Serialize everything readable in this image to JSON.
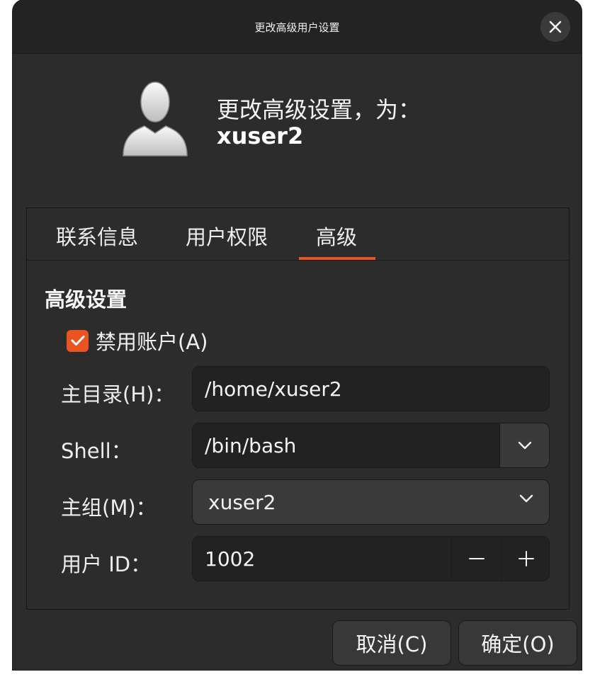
{
  "window": {
    "title": "更改高级用户设置",
    "close_icon": "close-icon"
  },
  "header": {
    "line1": "更改高级设置，为：",
    "username": "xuser2",
    "avatar_icon": "user-avatar-icon"
  },
  "tabs": [
    {
      "label": "联系信息",
      "active": false
    },
    {
      "label": "用户权限",
      "active": false
    },
    {
      "label": "高级",
      "active": true
    }
  ],
  "advanced": {
    "section_title": "高级设置",
    "disable_account": {
      "label": "禁用账户(A)",
      "checked": true
    },
    "home_dir": {
      "label": "主目录(H)：",
      "value": "/home/xuser2"
    },
    "shell": {
      "label": "Shell：",
      "value": "/bin/bash"
    },
    "main_group": {
      "label": "主组(M)：",
      "value": "xuser2"
    },
    "user_id": {
      "label": "用户 ID：",
      "value": "1002"
    }
  },
  "buttons": {
    "cancel": "取消(C)",
    "ok": "确定(O)"
  },
  "colors": {
    "accent": "#e95420",
    "background": "#2c2c2c",
    "titlebar": "#232323"
  }
}
